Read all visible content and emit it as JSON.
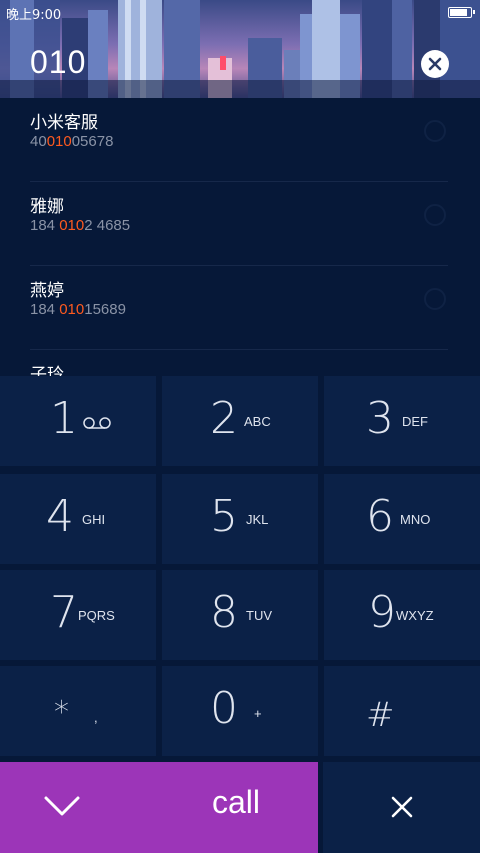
{
  "status_bar": {
    "time": "晚上9:00"
  },
  "dialer": {
    "input": "010"
  },
  "results": [
    {
      "name": "小米客服",
      "number_parts": [
        "40",
        "010",
        "05678"
      ]
    },
    {
      "name": "雅娜",
      "number_parts": [
        "184 ",
        "010",
        "2 4685"
      ]
    },
    {
      "name": "燕婷",
      "number_parts": [
        "184 ",
        "010",
        "15689"
      ]
    },
    {
      "name": "子玲",
      "number_parts": [
        "",
        "",
        ""
      ]
    }
  ],
  "keypad": {
    "keys": [
      {
        "digit": "1",
        "letters": ""
      },
      {
        "digit": "2",
        "letters": "ABC"
      },
      {
        "digit": "3",
        "letters": "DEF"
      },
      {
        "digit": "4",
        "letters": "GHI"
      },
      {
        "digit": "5",
        "letters": "JKL"
      },
      {
        "digit": "6",
        "letters": "MNO"
      },
      {
        "digit": "7",
        "letters": "PQRS"
      },
      {
        "digit": "8",
        "letters": "TUV"
      },
      {
        "digit": "9",
        "letters": "WXYZ"
      },
      {
        "digit": "*",
        "letters": ","
      },
      {
        "digit": "0",
        "letters": "+"
      },
      {
        "digit": "#",
        "letters": ""
      }
    ]
  },
  "actions": {
    "call_label": "call"
  },
  "colors": {
    "accent_call": "#9c35b8",
    "highlight": "#ff5a1f",
    "key_bg": "#0b2147",
    "page_bg": "#061838"
  }
}
